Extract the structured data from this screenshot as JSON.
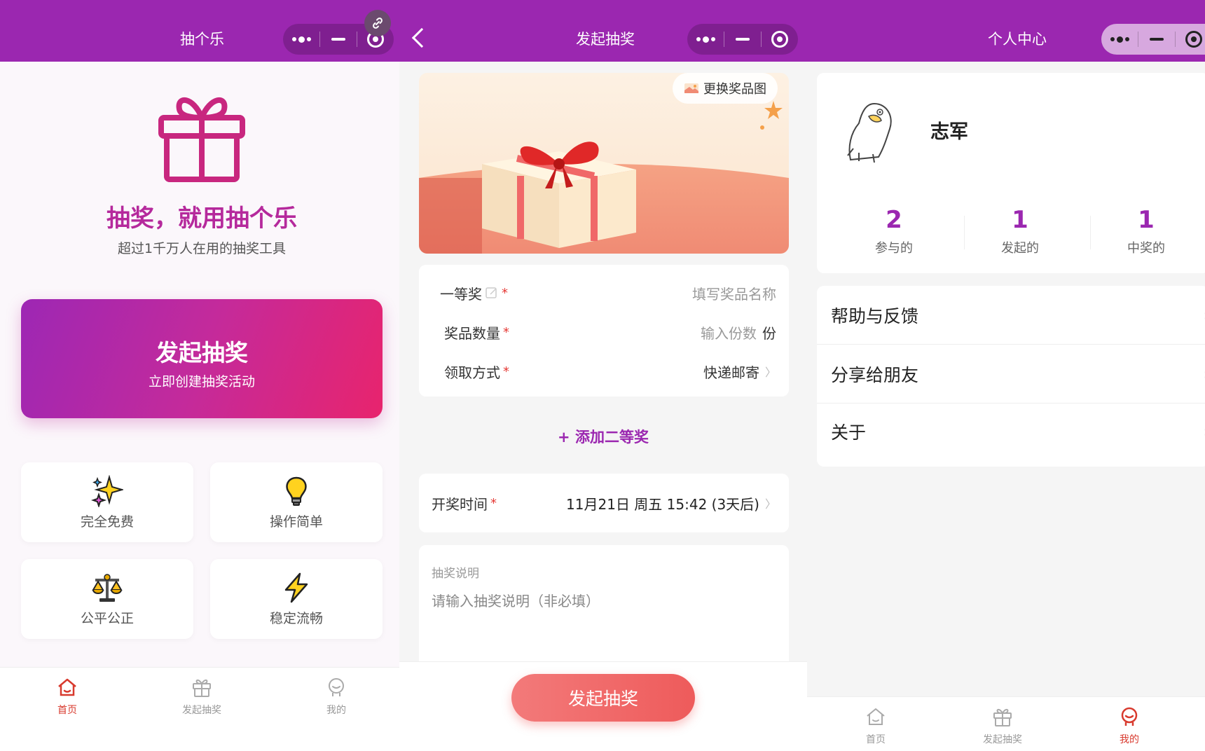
{
  "home": {
    "header_title": "抽个乐",
    "headline": "抽奖，就用抽个乐",
    "subtitle": "超过1千万人在用的抽奖工具",
    "cta_title": "发起抽奖",
    "cta_subtitle": "立即创建抽奖活动",
    "features": [
      {
        "label": "完全免费",
        "icon": "sparkles-icon"
      },
      {
        "label": "操作简单",
        "icon": "lightbulb-icon"
      },
      {
        "label": "公平公正",
        "icon": "scales-icon"
      },
      {
        "label": "稳定流畅",
        "icon": "lightning-icon"
      }
    ],
    "tabs": [
      {
        "label": "首页",
        "icon": "home-icon",
        "active": true
      },
      {
        "label": "发起抽奖",
        "icon": "gift-icon",
        "active": false
      },
      {
        "label": "我的",
        "icon": "user-icon",
        "active": false
      }
    ]
  },
  "create": {
    "header_title": "发起抽奖",
    "change_pic": "更换奖品图",
    "prize_level": "一等奖",
    "prize_name_placeholder": "填写奖品名称",
    "quantity_label": "奖品数量",
    "quantity_placeholder": "输入份数",
    "quantity_unit": "份",
    "claim_label": "领取方式",
    "claim_value": "快递邮寄",
    "add_second": "+ 添加二等奖",
    "draw_time_label": "开奖时间",
    "draw_time_value": "11月21日 周五 15:42 (3天后)",
    "desc_label": "抽奖说明",
    "desc_placeholder": "请输入抽奖说明（非必填）",
    "submit": "发起抽奖",
    "required_mark": "*",
    "arrow": "〉"
  },
  "profile": {
    "header_title": "个人中心",
    "username": "志军",
    "stats": [
      {
        "value": "2",
        "label": "参与的"
      },
      {
        "value": "1",
        "label": "发起的"
      },
      {
        "value": "1",
        "label": "中奖的"
      }
    ],
    "menu": [
      {
        "label": "帮助与反馈"
      },
      {
        "label": "分享给朋友"
      },
      {
        "label": "关于"
      }
    ],
    "tabs": [
      {
        "label": "首页",
        "active": false
      },
      {
        "label": "发起抽奖",
        "active": false
      },
      {
        "label": "我的",
        "active": true
      }
    ]
  },
  "colors": {
    "header": "#9b27b0",
    "brand_text": "#b5299c",
    "cta_start": "#9d27b4",
    "cta_end": "#e8246d",
    "active_tab": "#d83a2e",
    "submit": "#ee5b5b"
  }
}
